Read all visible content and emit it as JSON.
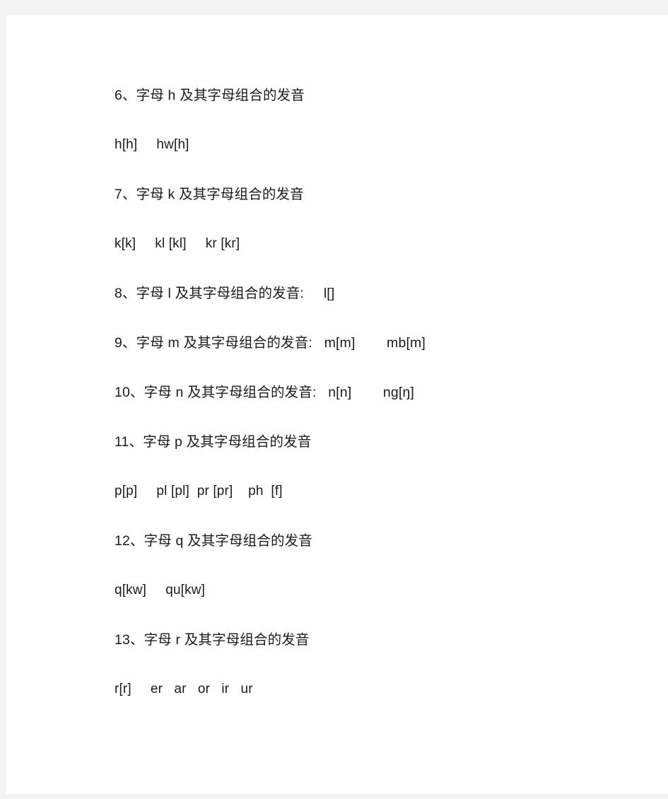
{
  "document": {
    "page_background": "#ffffff",
    "viewer_background": "#f3f3f3",
    "text_color": "#1b1b1b",
    "lines": [
      {
        "id": "heading-h",
        "kind": "heading",
        "text": "6、字母 h 及其字母组合的发音"
      },
      {
        "id": "examples-h",
        "kind": "example",
        "text": "h[h]     hw[h]"
      },
      {
        "id": "heading-k",
        "kind": "heading",
        "text": "7、字母 k 及其字母组合的发音"
      },
      {
        "id": "examples-k",
        "kind": "example",
        "text": "k[k]     kl [kl]     kr [kr]"
      },
      {
        "id": "heading-l",
        "kind": "heading",
        "text": "8、字母 l 及其字母组合的发音:     l[]"
      },
      {
        "id": "heading-m",
        "kind": "heading",
        "text": "9、字母 m 及其字母组合的发音:   m[m]        mb[m]"
      },
      {
        "id": "heading-n",
        "kind": "heading",
        "text": "10、字母 n 及其字母组合的发音:   n[n]        ng[ŋ]"
      },
      {
        "id": "heading-p",
        "kind": "heading",
        "text": "11、字母 p 及其字母组合的发音"
      },
      {
        "id": "examples-p",
        "kind": "example",
        "text": "p[p]     pl [pl]  pr [pr]    ph  [f]"
      },
      {
        "id": "heading-q",
        "kind": "heading",
        "text": "12、字母 q 及其字母组合的发音"
      },
      {
        "id": "examples-q",
        "kind": "example",
        "text": "q[kw]     qu[kw]"
      },
      {
        "id": "heading-r",
        "kind": "heading",
        "text": "13、字母 r 及其字母组合的发音"
      },
      {
        "id": "examples-r",
        "kind": "example",
        "text": "r[r]     er   ar   or   ir   ur"
      }
    ]
  }
}
